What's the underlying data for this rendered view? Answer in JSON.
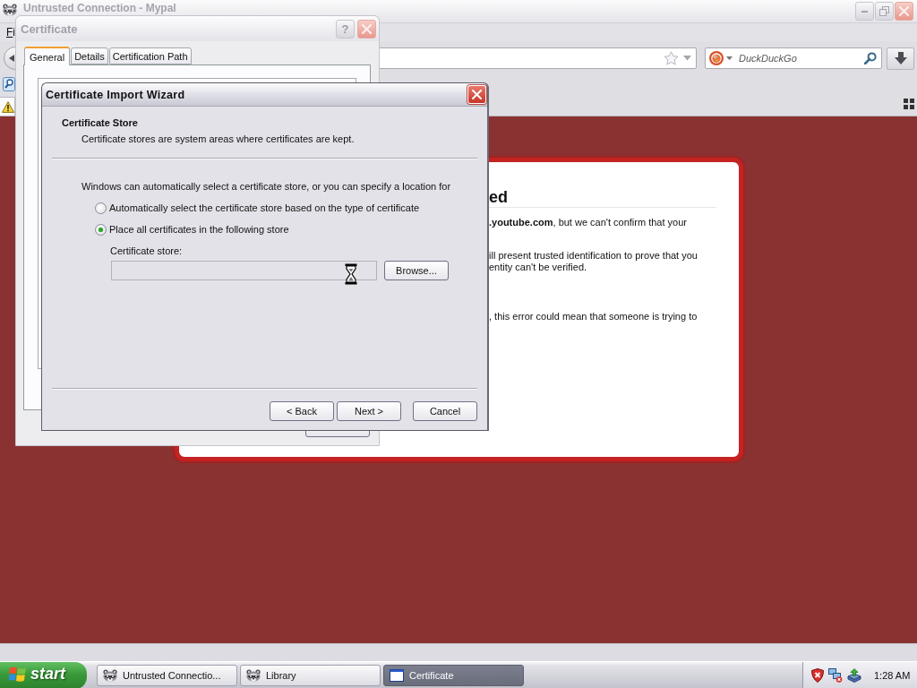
{
  "browser": {
    "title": "Untrusted Connection - Mypal",
    "menu": [
      {
        "label": "Fi"
      }
    ],
    "search": {
      "placeholder": "DuckDuckGo"
    },
    "page": {
      "heading": "ed",
      "paragraphs": [
        [
          "**.youtube.com**, but we can't confirm that your"
        ],
        [
          "ill present trusted identification to prove that you",
          "entity can't be verified."
        ],
        [
          ", this error could mean that someone is trying to"
        ]
      ]
    }
  },
  "certificate_dialog": {
    "title": "Certificate",
    "help_button": "?",
    "tabs": [
      {
        "label": "General",
        "selected": true
      },
      {
        "label": "Details",
        "selected": false
      },
      {
        "label": "Certification Path",
        "selected": false
      }
    ]
  },
  "wizard": {
    "title": "Certificate Import Wizard",
    "section_title": "Certificate Store",
    "section_subtitle": "Certificate stores are system areas where certificates are kept.",
    "intro": "Windows can automatically select a certificate store, or you can specify a location for",
    "options": [
      {
        "label": "Automatically select the certificate store based on the type of certificate",
        "selected": false
      },
      {
        "label": "Place all certificates in the following store",
        "selected": true
      }
    ],
    "store_label": "Certificate store:",
    "store_field": {
      "read_only": true
    },
    "browse_button": "Browse...",
    "buttons": [
      "< Back",
      "Next >",
      "Cancel"
    ]
  },
  "taskbar": {
    "start": "start",
    "tasks": [
      {
        "label": "Untrusted Connectio...",
        "kind": "browser",
        "selected": false
      },
      {
        "label": "Library",
        "kind": "browser",
        "selected": false
      },
      {
        "label": "Certificate",
        "kind": "window",
        "selected": true
      }
    ],
    "clock": "1:28 AM"
  }
}
